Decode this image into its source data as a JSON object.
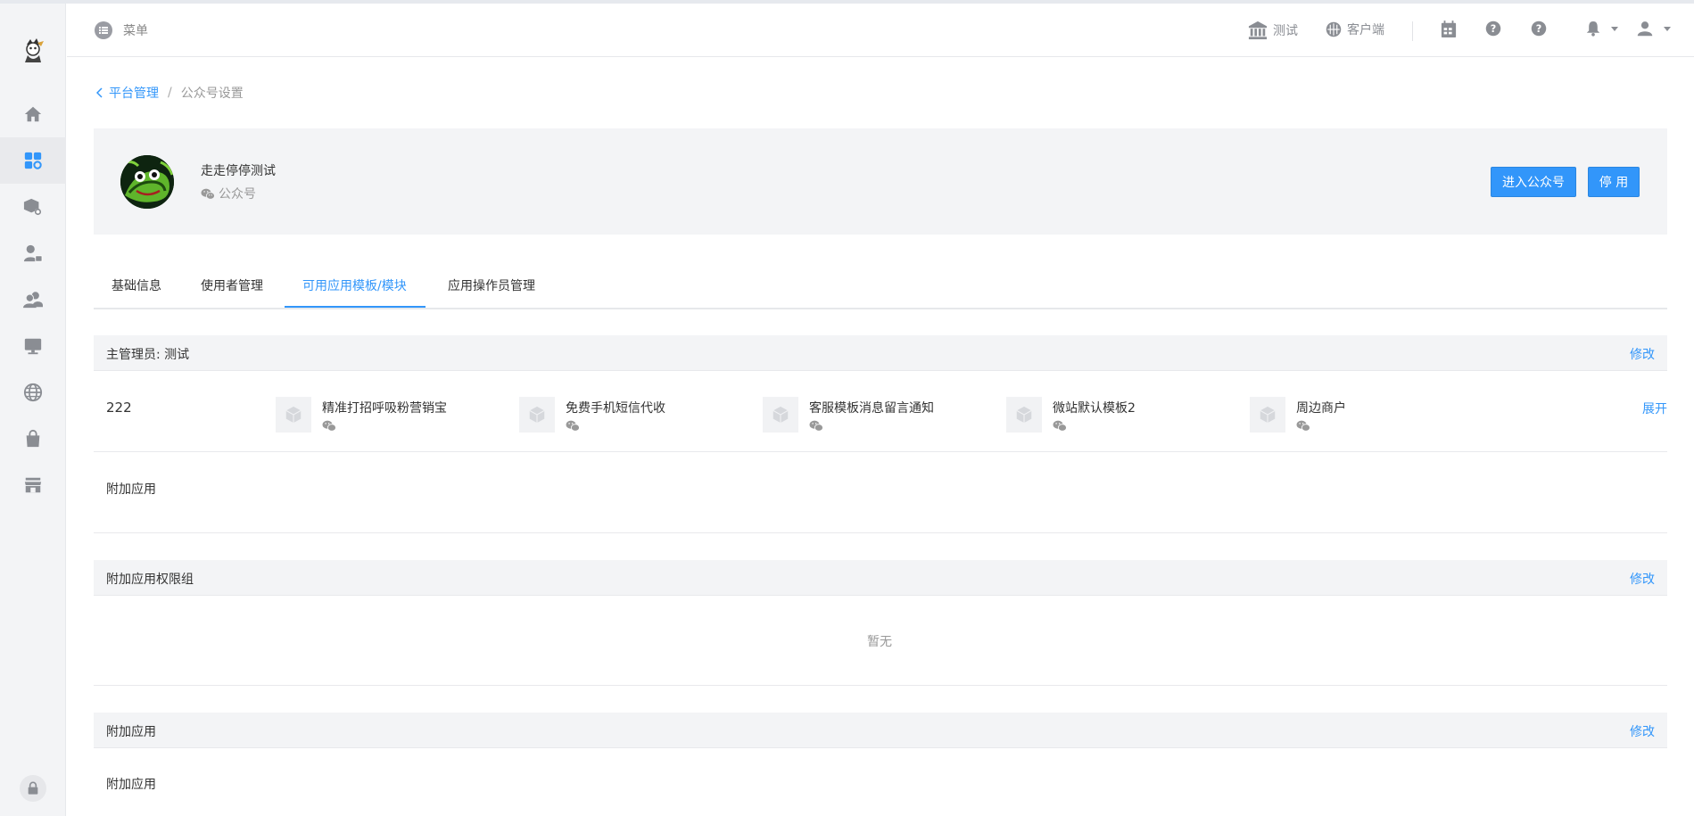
{
  "header": {
    "menu_label": "菜单",
    "org_label": "测试",
    "client_label": "客户端"
  },
  "breadcrumb": {
    "parent": "平台管理",
    "separator": "/",
    "current": "公众号设置"
  },
  "account": {
    "name": "走走停停测试",
    "type": "公众号",
    "enter_button": "进入公众号",
    "disable_button": "停 用"
  },
  "tabs": [
    {
      "label": "基础信息"
    },
    {
      "label": "使用者管理"
    },
    {
      "label": "可用应用模板/模块"
    },
    {
      "label": "应用操作员管理"
    }
  ],
  "active_tab": "可用应用模板/模块",
  "section_admin": {
    "title": "主管理员: 测试",
    "edit": "修改",
    "group_name": "222",
    "apps": [
      {
        "name": "精准打招呼吸粉营销宝"
      },
      {
        "name": "免费手机短信代收"
      },
      {
        "name": "客服模板消息留言通知"
      },
      {
        "name": "微站默认模板2"
      },
      {
        "name": "周边商户"
      }
    ],
    "expand": "展开",
    "extra_label": "附加应用"
  },
  "section_perm_group": {
    "title": "附加应用权限组",
    "edit": "修改",
    "empty": "暂无"
  },
  "section_extra": {
    "title": "附加应用",
    "edit": "修改",
    "content": "附加应用"
  },
  "colors": {
    "primary": "#3296fa",
    "sidebar_bg": "#f3f4f6",
    "icon_gray": "#8a8d93"
  }
}
